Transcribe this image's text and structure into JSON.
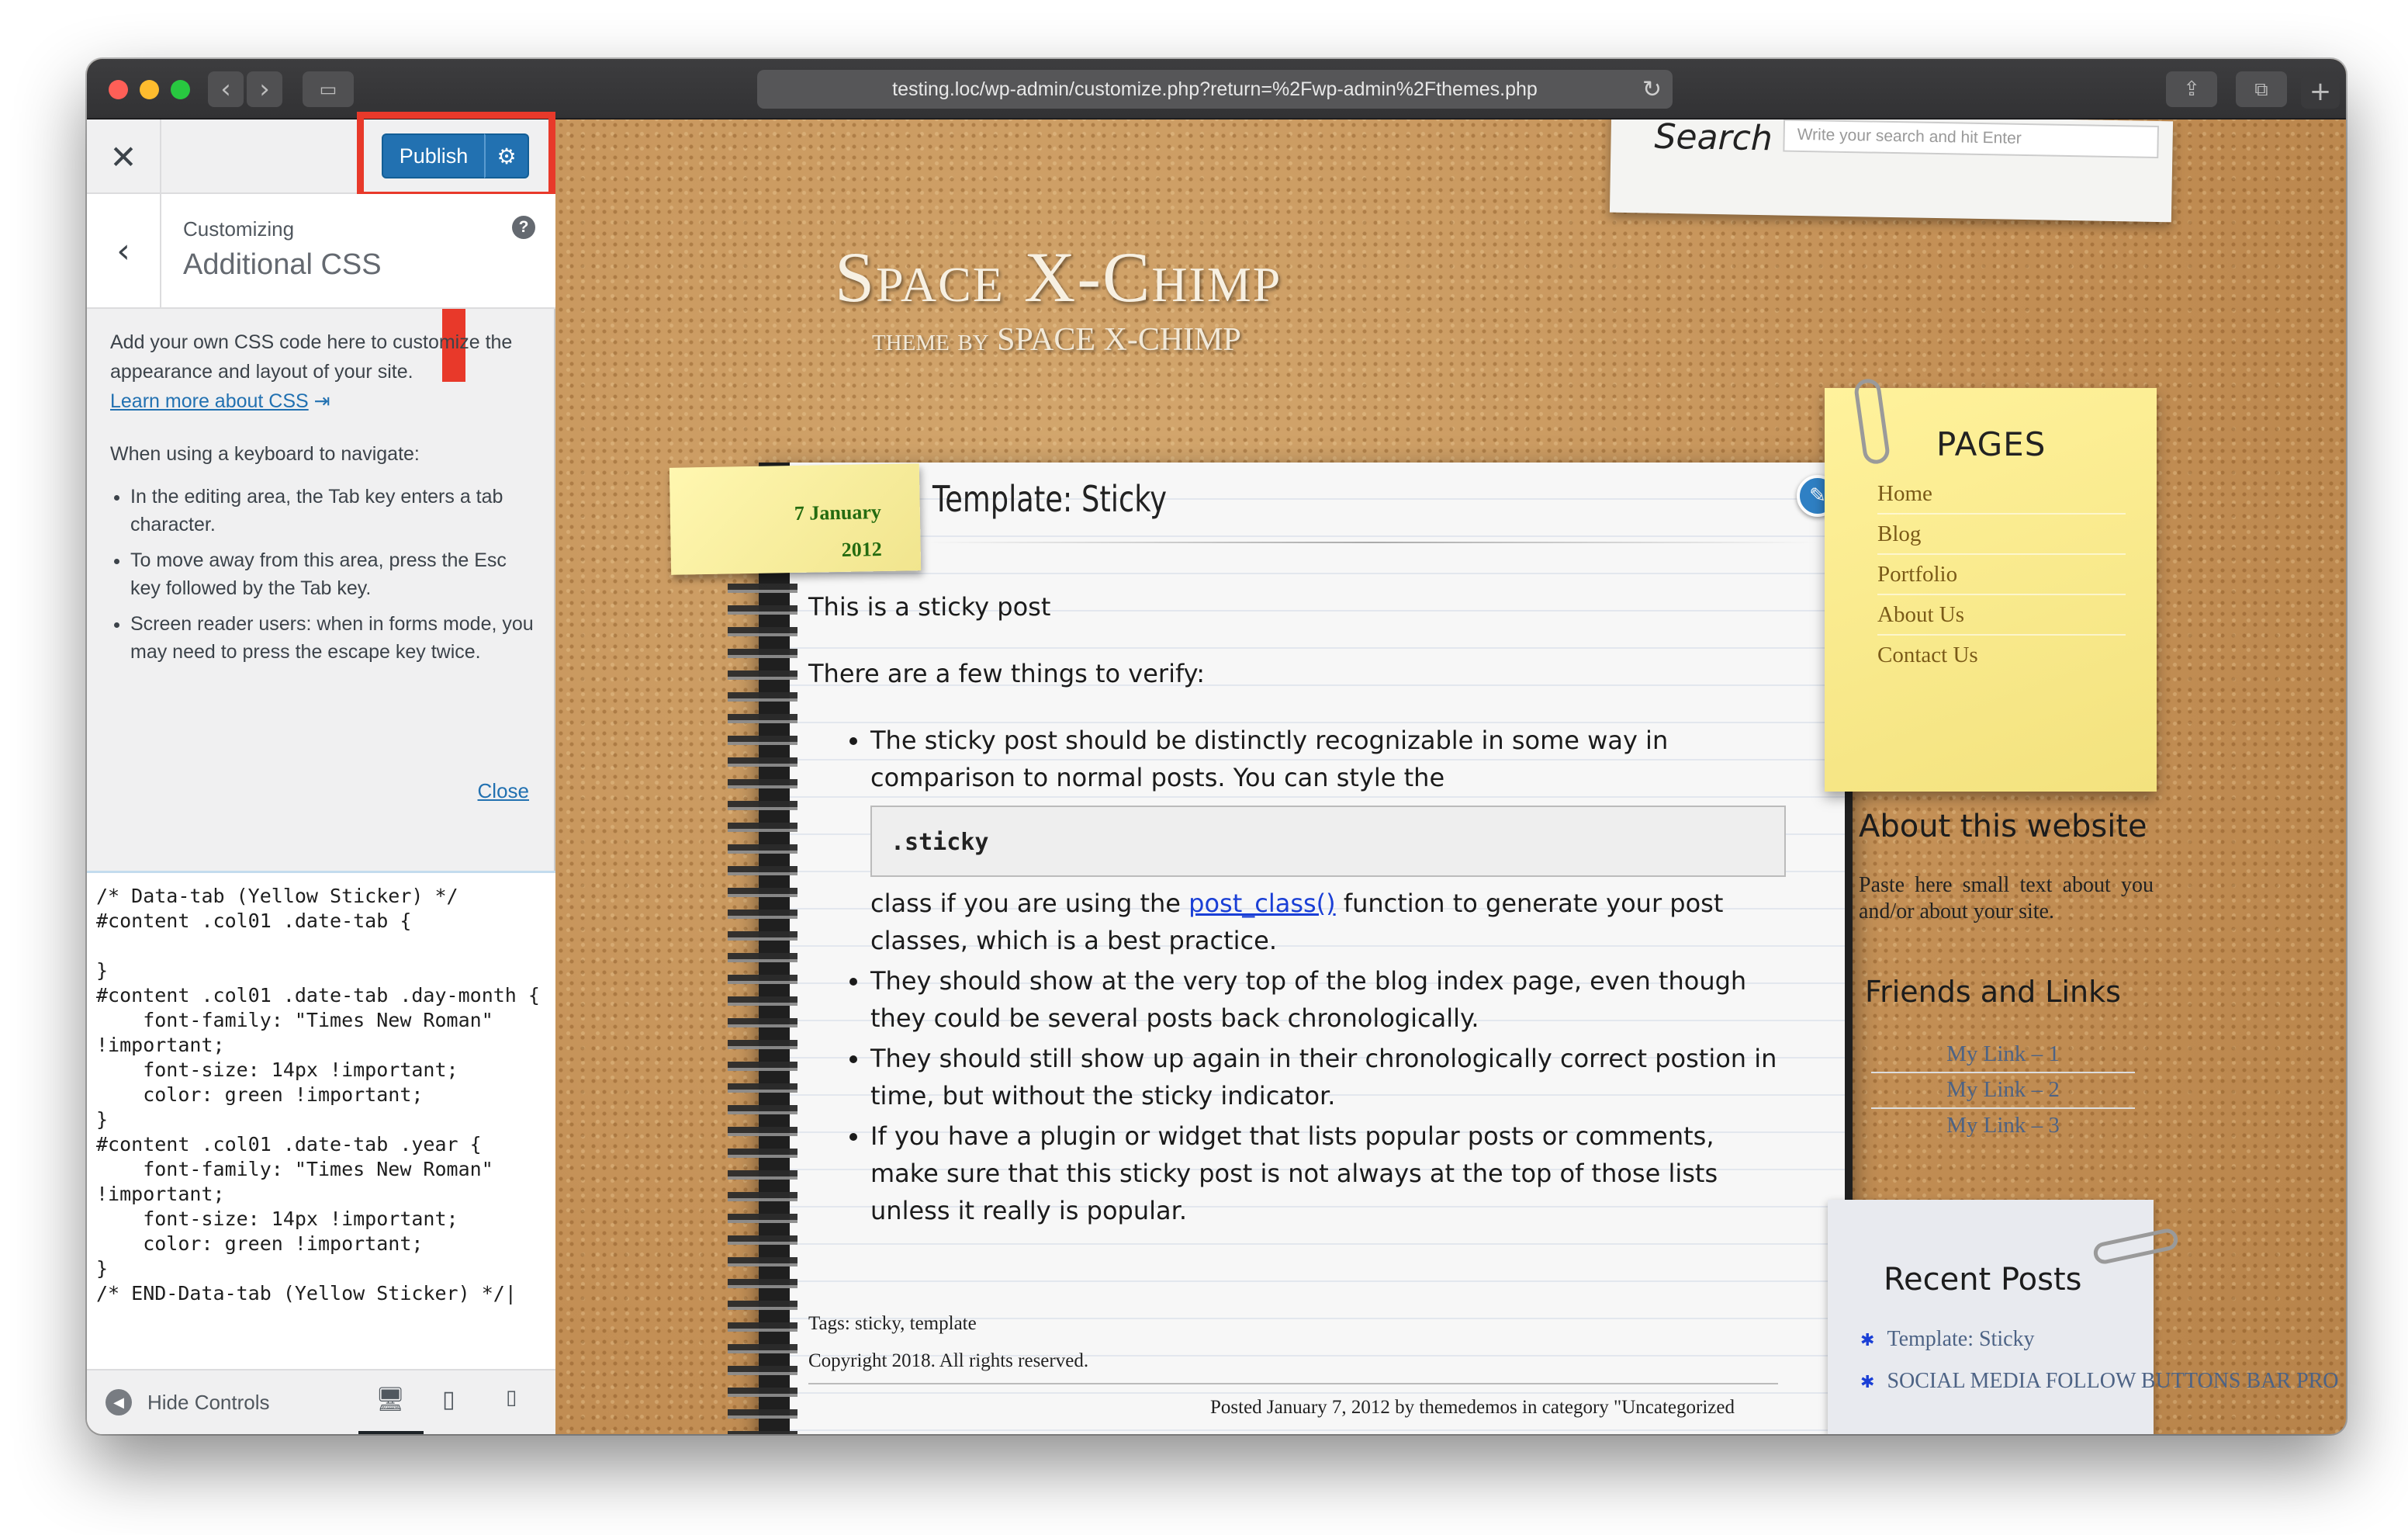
{
  "browser": {
    "url": "testing.loc/wp-admin/customize.php?return=%2Fwp-admin%2Fthemes.php",
    "new_tab": "+"
  },
  "customizer": {
    "publish_label": "Publish",
    "customizing_label": "Customizing",
    "section_title": "Additional CSS",
    "description": "Add your own CSS code here to customize the appearance and layout of your site.",
    "learn_more": "Learn more about CSS",
    "keyboard_intro": "When using a keyboard to navigate:",
    "keyboard_tips": [
      "In the editing area, the Tab key enters a tab character.",
      "To move away from this area, press the Esc key followed by the Tab key.",
      "Screen reader users: when in forms mode, you may need to press the escape key twice."
    ],
    "close_label": "Close",
    "css_code": "/* Data-tab (Yellow Sticker) */\n#content .col01 .date-tab {\n\n}\n#content .col01 .date-tab .day-month {\n    font-family: \"Times New Roman\"\n!important;\n    font-size: 14px !important;\n    color: green !important;\n}\n#content .col01 .date-tab .year {\n    font-family: \"Times New Roman\"\n!important;\n    font-size: 14px !important;\n    color: green !important;\n}\n/* END-Data-tab (Yellow Sticker) */|",
    "hide_controls": "Hide Controls"
  },
  "site": {
    "search_label": "Search",
    "search_placeholder": "Write your search and hit Enter",
    "brand": "Space X-Chimp",
    "tagline": "theme by SPACE X-CHIMP",
    "post": {
      "date_day_month": "7 January",
      "date_year": "2012",
      "title": "Template: Sticky",
      "intro1": "This is a sticky post",
      "intro2": "There are a few things to verify:",
      "b1_text": "The sticky post should be distinctly recognizable in some way in comparison to normal posts. You can style the",
      "b1_code": ".sticky",
      "b1_after_pre": "class if you are using the",
      "b1_link": "post_class()",
      "b1_after_link": "function to generate your post classes, which is a best practice.",
      "b2": "They should show at the very top of the blog index page, even though they could be several posts back chronologically.",
      "b3": "They should still show up again in their chronologically correct postion in time, but without the sticky indicator.",
      "b4": "If you have a plugin or widget that lists popular posts or comments, make sure that this sticky post is not always at the top of those lists unless it really is popular.",
      "tags": "Tags: sticky, template",
      "copyright": "Copyright 2018. All rights reserved.",
      "posted": "Posted January 7, 2012 by themedemos in category \"Uncategorized"
    },
    "pages_title": "PAGES",
    "pages": [
      "Home",
      "Blog",
      "Portfolio",
      "About Us",
      "Contact Us"
    ],
    "about_title": "About this website",
    "about_text": "Paste here small text about you and/or about your site.",
    "friends_title": "Friends and Links",
    "friends": [
      "My Link – 1",
      "My Link – 2",
      "My Link – 3"
    ],
    "recent_title": "Recent Posts",
    "recent": [
      "Template: Sticky",
      "SOCIAL MEDIA FOLLOW BUTTONS BAR PRO"
    ]
  }
}
